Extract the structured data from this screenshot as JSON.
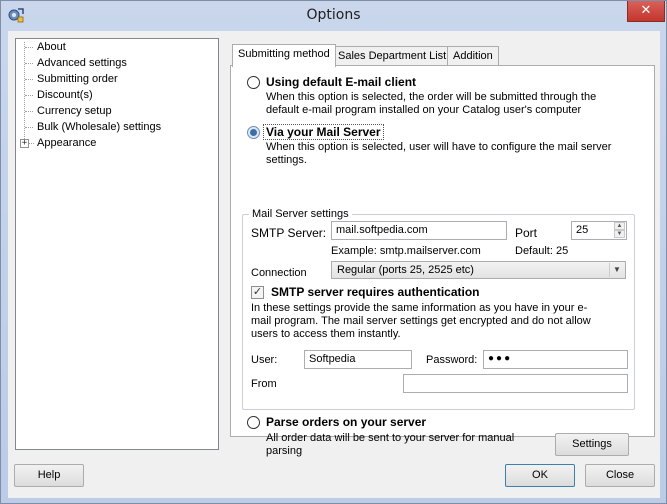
{
  "window": {
    "title": "Options",
    "close_glyph": "✕"
  },
  "tree": {
    "items": [
      {
        "label": "About"
      },
      {
        "label": "Advanced settings"
      },
      {
        "label": "Submitting order"
      },
      {
        "label": "Discount(s)"
      },
      {
        "label": "Currency setup"
      },
      {
        "label": "Bulk (Wholesale) settings"
      },
      {
        "label": "Appearance",
        "expander": "+"
      }
    ]
  },
  "tabs": [
    {
      "label": "Submitting method",
      "active": true
    },
    {
      "label": "Sales Department List",
      "active": false
    },
    {
      "label": "Addition",
      "active": false
    }
  ],
  "submitting": {
    "option_default": {
      "label": "Using default E-mail client",
      "desc": "When this option is selected, the order will be submitted through the default e-mail program installed on your Catalog user's computer",
      "checked": false
    },
    "option_mail_server": {
      "label": "Via your Mail Server",
      "desc": "When this option is selected, user will have to configure the mail server settings.",
      "checked": true
    },
    "mail_server": {
      "group_title": "Mail Server settings",
      "smtp_label": "SMTP Server:",
      "smtp_value": "mail.softpedia.com",
      "port_label": "Port",
      "port_value": "25",
      "example": "Example: smtp.mailserver.com",
      "default_port": "Default: 25",
      "connection_label": "Connection",
      "connection_value": "Regular (ports 25, 2525 etc)",
      "auth_label": "SMTP server requires authentication",
      "auth_checked": true,
      "auth_desc": "In these settings provide the same information as you have in your e-mail program. The mail server settings get encrypted and do not allow users to access them instantly.",
      "user_label": "User:",
      "user_value": "Softpedia",
      "password_label": "Password:",
      "password_value": "●●●",
      "from_label": "From",
      "from_value": ""
    },
    "option_parse": {
      "label": "Parse orders on your server",
      "desc": "All order data will be sent to your server for manual parsing",
      "checked": false
    },
    "settings_button": "Settings"
  },
  "footer": {
    "help": "Help",
    "ok": "OK",
    "close": "Close"
  },
  "colors": {
    "titlebar": "#c9d6ec",
    "close": "#c7433c",
    "accent": "#3c7fb1"
  }
}
